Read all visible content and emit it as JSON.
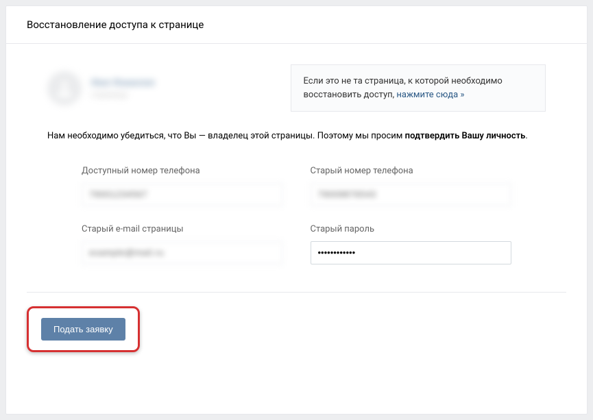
{
  "header": {
    "title": "Восстановление доступа к странице"
  },
  "profile": {
    "name": "Имя Фамилия",
    "sub": "страница"
  },
  "infoBox": {
    "line1": "Если это не та страница, к которой необходимо восстановить доступ, ",
    "link": "нажмите сюда »"
  },
  "lead": {
    "part1": "Нам необходимо убедиться, что Вы — владелец этой страницы. Поэтому мы просим ",
    "bold": "подтвердить Вашу личность",
    "part2": "."
  },
  "fields": {
    "availablePhone": {
      "label": "Доступный номер телефона",
      "value": "79001234567"
    },
    "oldPhone": {
      "label": "Старый номер телефона",
      "value": "79009876543"
    },
    "oldEmail": {
      "label": "Старый e-mail страницы",
      "value": "example@mail.ru"
    },
    "oldPassword": {
      "label": "Старый пароль",
      "value": "••••••••••••"
    }
  },
  "submit": {
    "label": "Подать заявку"
  }
}
